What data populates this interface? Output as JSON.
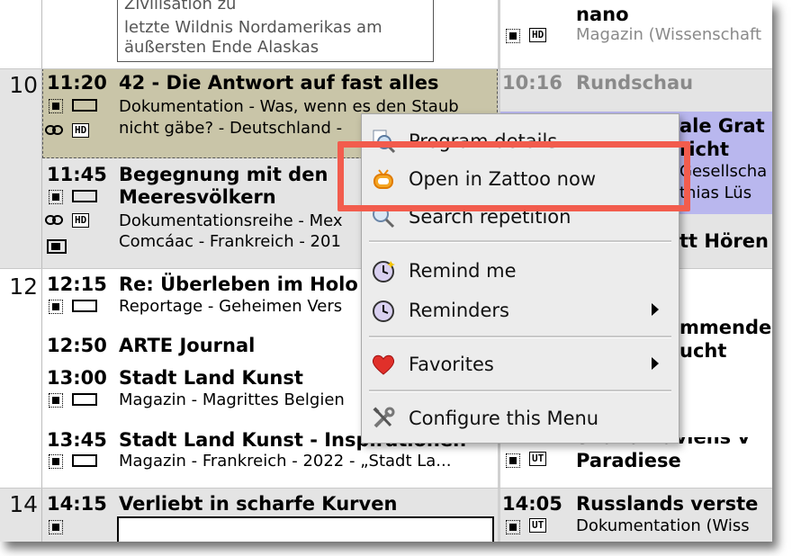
{
  "left_column": {
    "top_desc_line0": "Zivilisation zu",
    "top_desc_line1": "letzte Wildnis Nordamerikas am",
    "top_desc_line2": "äußersten Ende Alaskas",
    "hours": [
      "10",
      "12",
      "14"
    ],
    "programs": [
      {
        "time": "11:20",
        "title": "42 - Die Antwort auf fast alles",
        "desc1": "Dokumentation - Was, wenn es den Staub",
        "desc2": "nicht gäbe? - Deutschland -",
        "hd": "HD"
      },
      {
        "time": "11:45",
        "title": "Begegnung mit den",
        "title2": "Meeresvölkern",
        "desc1": "Dokumentationsreihe - Mex",
        "desc2": "Comcáac - Frankreich - 201",
        "hd": "HD"
      },
      {
        "time": "12:15",
        "title": "Re: Überleben im Holo",
        "desc1": "Reportage - Geheimen Vers"
      },
      {
        "time": "12:50",
        "title": "ARTE Journal"
      },
      {
        "time": "13:00",
        "title": "Stadt Land Kunst",
        "desc1": "Magazin - Magrittes Belgien"
      },
      {
        "time": "13:45",
        "title": "Stadt Land Kunst - Inspirationen",
        "desc1": "Magazin - Frankreich - 2022 - „Stadt La..."
      },
      {
        "time": "14:15",
        "title": "Verliebt in scharfe Kurven"
      }
    ]
  },
  "right_column": {
    "top_title": "nano",
    "top_desc": "Magazin (Wissenschaft",
    "top_hd": "HD",
    "rundschau_time": "10:16",
    "rundschau_title": "Rundschau",
    "purple_line1": "ale Grat",
    "purple_line2": "richt",
    "purple_line3": "Gesellscha",
    "purple_line4": "thias Lüs",
    "item_hoeren": "tt Hören",
    "item_mmender": "mmender",
    "item_ucht": "ucht",
    "item_skandinaviens": "Skandinaviens v",
    "item_paradiese": "Paradiese",
    "item_ut": "UT",
    "bottom_time": "14:05",
    "bottom_title": "Russlands verste",
    "bottom_desc": "Dokumentation (Wiss",
    "bottom_ut": "UT"
  },
  "context_menu": {
    "items": [
      {
        "label": "Program details",
        "icon": "magnifier-info-icon"
      },
      {
        "label": "Open in Zattoo now",
        "icon": "zattoo-tv-icon"
      },
      {
        "label": "Search repetition",
        "icon": "search-icon"
      },
      {
        "label": "Remind me",
        "icon": "reminder-clock-icon"
      },
      {
        "label": "Reminders",
        "icon": "reminders-clock-icon",
        "submenu": true
      },
      {
        "label": "Favorites",
        "icon": "heart-icon",
        "submenu": true
      },
      {
        "label": "Configure this Menu",
        "icon": "tools-icon"
      }
    ]
  },
  "colors": {
    "selected_program_bg": "#c9c5a8",
    "hour_band_bg": "#e4e4e4",
    "purple_program_bg": "#b9b7ee",
    "highlight_border": "#f25c4d",
    "menu_bg": "#ececec"
  }
}
